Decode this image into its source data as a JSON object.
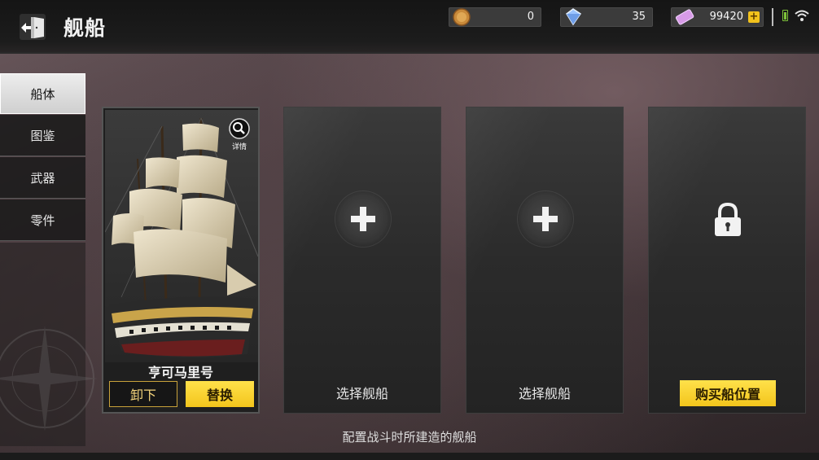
{
  "header": {
    "title": "舰船",
    "resources": [
      {
        "name": "coin",
        "value": "0",
        "icon": "coin-icon",
        "color": "#c98a3a"
      },
      {
        "name": "diamond",
        "value": "35",
        "icon": "diamond-icon",
        "color": "#7fb0ff"
      },
      {
        "name": "ticket",
        "value": "99420",
        "icon": "ticket-icon",
        "color": "#d89be8"
      }
    ]
  },
  "sidebar": {
    "items": [
      {
        "label": "船体",
        "active": true
      },
      {
        "label": "图鉴",
        "active": false
      },
      {
        "label": "武器",
        "active": false
      },
      {
        "label": "零件",
        "active": false
      }
    ]
  },
  "slots": {
    "ship": {
      "name": "亨可马里号",
      "detail_label": "详情",
      "unequip_label": "卸下",
      "replace_label": "替换"
    },
    "empty_1": {
      "label": "选择舰船"
    },
    "empty_2": {
      "label": "选择舰船"
    },
    "locked": {
      "buy_label": "购买船位置"
    }
  },
  "footer": {
    "hint": "配置战斗时所建造的舰船"
  },
  "colors": {
    "accent_yellow": "#f3c51c",
    "button_border_gold": "#c8a23a"
  }
}
